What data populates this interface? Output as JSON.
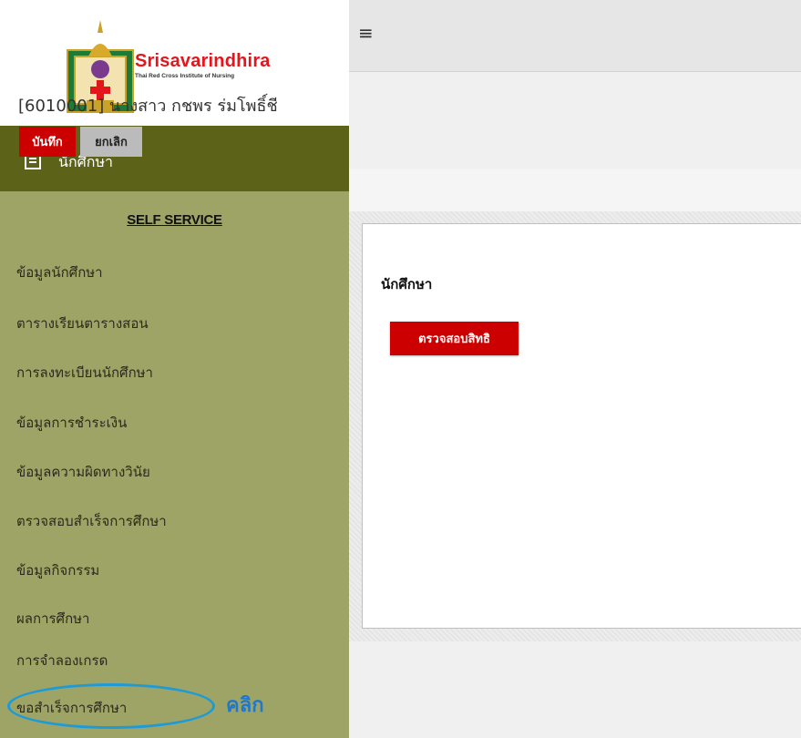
{
  "logo": {
    "title": "Srisavarindhira",
    "subtitle": "Thai Red Cross Institute of Nursing"
  },
  "menu_header": {
    "icon": "document-icon",
    "label": "นักศึกษา"
  },
  "sidebar": {
    "section_title": "SELF SERVICE",
    "items": [
      {
        "label": "ข้อมูลนักศึกษา"
      },
      {
        "label": "ตารางเรียนตารางสอน"
      },
      {
        "label": "การลงทะเบียนนักศึกษา"
      },
      {
        "label": "ข้อมูลการชำระเงิน"
      },
      {
        "label": "ข้อมูลความผิดทางวินัย"
      },
      {
        "label": "ตรวจสอบสำเร็จการศึกษา"
      },
      {
        "label": "ข้อมูลกิจกรรม"
      },
      {
        "label": "ผลการศึกษา"
      },
      {
        "label": "การจำลองเกรด"
      },
      {
        "label": "ขอสำเร็จการศึกษา"
      }
    ]
  },
  "annotation": {
    "label": "คลิก",
    "color": "#1e9bd7"
  },
  "topbar": {
    "icon": "hamburger-menu-icon",
    "glyph": "≡"
  },
  "header": {
    "title": "[6010001] นางสาว กชพร ร่มโพธิ์ชี",
    "save_label": "บันทึก",
    "cancel_label": "ยกเลิก"
  },
  "card": {
    "title": "นักศึกษา",
    "check_label": "ตรวจสอบสิทธิ"
  },
  "colors": {
    "accent": "#cc0000",
    "sidebar": "#9da466",
    "sidebar_header": "#5c6218"
  }
}
